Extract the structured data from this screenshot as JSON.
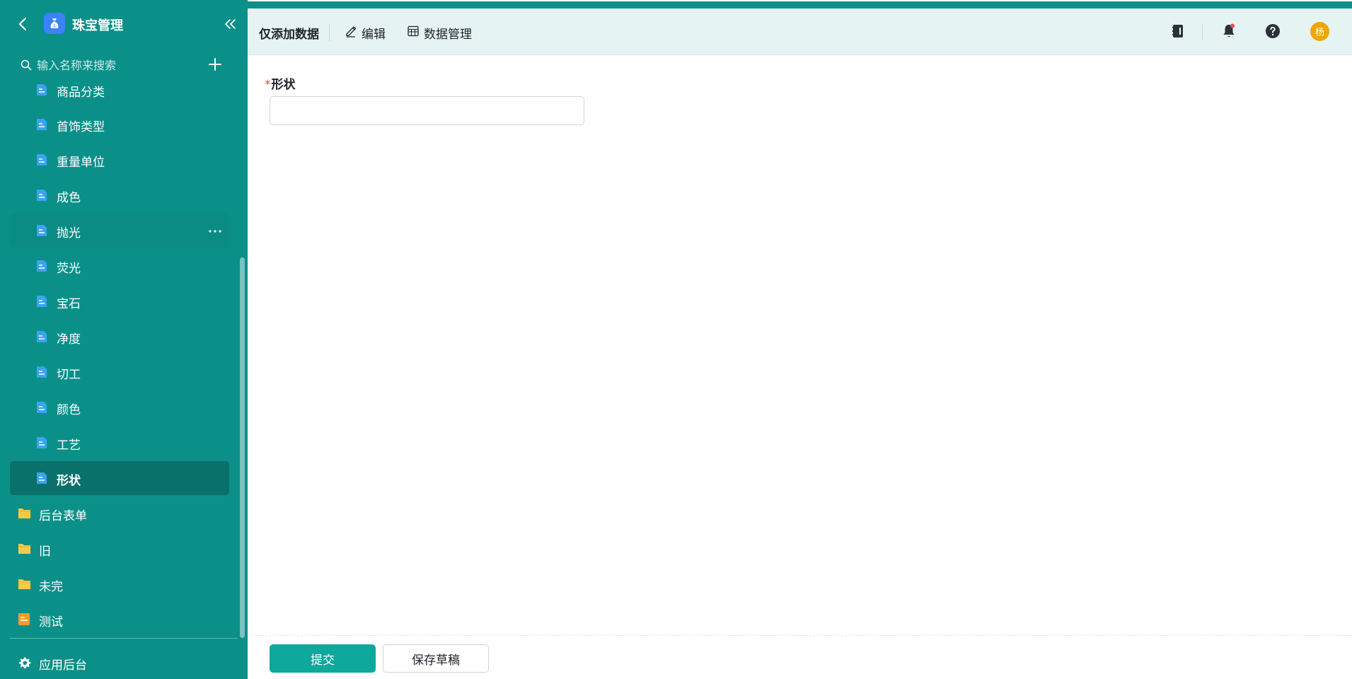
{
  "app": {
    "title": "珠宝管理",
    "colors": {
      "sidebar": "#0b9089",
      "active_item": "#0a706a",
      "accent_button": "#0ea89d",
      "file_icon": "#3aa4f0",
      "folder_icon": "#f7c948",
      "test_icon": "#f59b2c",
      "avatar": "#f0a400",
      "required": "#e24b4b"
    }
  },
  "sidebar": {
    "search_placeholder": "输入名称来搜索",
    "items": [
      {
        "label": "商品分类",
        "type": "form",
        "icon": "file-form-icon"
      },
      {
        "label": "首饰类型",
        "type": "form",
        "icon": "file-form-icon"
      },
      {
        "label": "重量单位",
        "type": "form",
        "icon": "file-form-icon"
      },
      {
        "label": "成色",
        "type": "form",
        "icon": "file-form-icon"
      },
      {
        "label": "抛光",
        "type": "form",
        "icon": "file-form-icon",
        "hover": true
      },
      {
        "label": "荧光",
        "type": "form",
        "icon": "file-form-icon"
      },
      {
        "label": "宝石",
        "type": "form",
        "icon": "file-form-icon"
      },
      {
        "label": "净度",
        "type": "form",
        "icon": "file-form-icon"
      },
      {
        "label": "切工",
        "type": "form",
        "icon": "file-form-icon"
      },
      {
        "label": "颜色",
        "type": "form",
        "icon": "file-form-icon"
      },
      {
        "label": "工艺",
        "type": "form",
        "icon": "file-form-icon"
      },
      {
        "label": "形状",
        "type": "form",
        "icon": "file-form-icon",
        "active": true
      },
      {
        "label": "后台表单",
        "type": "folder",
        "icon": "folder-icon"
      },
      {
        "label": "旧",
        "type": "folder",
        "icon": "folder-icon"
      },
      {
        "label": "未完",
        "type": "folder",
        "icon": "folder-icon"
      },
      {
        "label": "测试",
        "type": "report",
        "icon": "report-icon"
      }
    ],
    "footer_label": "应用后台"
  },
  "toolbar": {
    "title": "仅添加数据",
    "edit_label": "编辑",
    "data_manage_label": "数据管理",
    "avatar_text": "杨"
  },
  "form": {
    "field_label": "形状",
    "required_mark": "*",
    "field_value": "",
    "submit_label": "提交",
    "draft_label": "保存草稿"
  }
}
